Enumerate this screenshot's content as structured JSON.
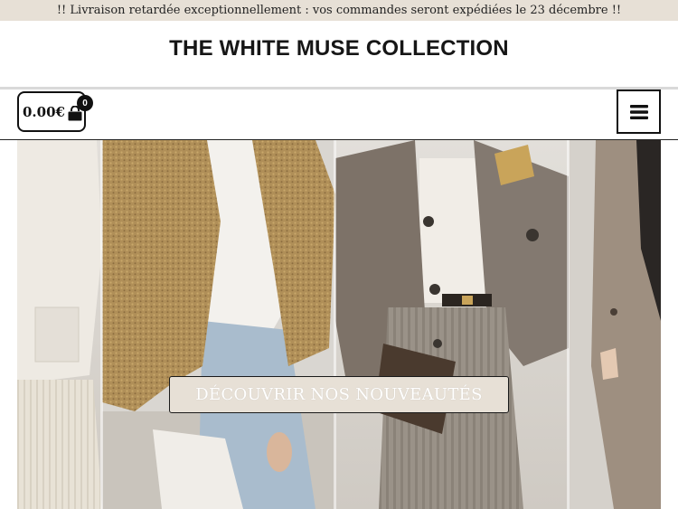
{
  "announcement": "!! Livraison retardée exceptionnellement : vos commandes seront expédiées le 23 décembre !!",
  "brand": {
    "title": "THE WHITE MUSE COLLECTION"
  },
  "cart": {
    "total": "0.00€",
    "count": "0",
    "icon": "shopping-bag-icon"
  },
  "menu": {
    "icon": "hamburger-menu-icon"
  },
  "hero": {
    "image": "fashion-coats-collage",
    "cta_label": "DÉCOUVRIR NOS NOUVEAUTÉS"
  },
  "colors": {
    "announcement_bg": "#e7e0d6",
    "cta_bg": "#e7e0d6",
    "text_dark": "#111111"
  }
}
